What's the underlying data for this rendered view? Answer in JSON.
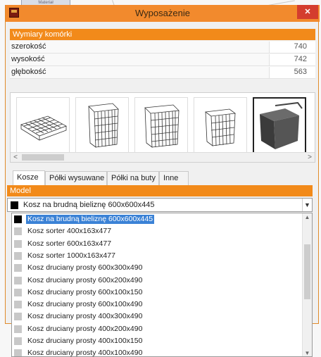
{
  "window": {
    "title": "Wyposażenie",
    "close_label": "✕"
  },
  "background": {
    "tab_label": "Materiał"
  },
  "dimensions": {
    "header": "Wymiary komórki",
    "rows": [
      {
        "label": "szerokość",
        "value": "740"
      },
      {
        "label": "wysokość",
        "value": "742"
      },
      {
        "label": "głębokość",
        "value": "563"
      }
    ]
  },
  "gallery": {
    "items": [
      {
        "name": "basket-tray",
        "selected": false
      },
      {
        "name": "wire-basket-tall",
        "selected": false
      },
      {
        "name": "wire-basket-tall-2",
        "selected": false
      },
      {
        "name": "wire-basket-sorter",
        "selected": false
      },
      {
        "name": "laundry-bin",
        "selected": true
      }
    ],
    "scroll_left": "<",
    "scroll_right": ">"
  },
  "tabs": [
    {
      "label": "Kosze",
      "active": true
    },
    {
      "label": "Półki wysuwane",
      "active": false
    },
    {
      "label": "Półki na buty",
      "active": false
    },
    {
      "label": "Inne",
      "active": false
    }
  ],
  "model": {
    "header": "Model",
    "selected": "Kosz na brudną bieliznę 600x600x445",
    "options": [
      "Kosz na brudną bieliznę 600x600x445",
      "Kosz sorter 400x163x477",
      "Kosz sorter 600x163x477",
      "Kosz sorter 1000x163x477",
      "Kosz druciany prosty 600x300x490",
      "Kosz druciany prosty 600x200x490",
      "Kosz druciany prosty 600x100x150",
      "Kosz druciany prosty 600x100x490",
      "Kosz druciany prosty 400x300x490",
      "Kosz druciany prosty 400x200x490",
      "Kosz druciany prosty 400x100x150",
      "Kosz druciany prosty 400x100x490"
    ],
    "selected_index": 0
  },
  "colors": {
    "accent": "#f28a1a",
    "selection": "#3b82d6",
    "close": "#d43d2e"
  }
}
